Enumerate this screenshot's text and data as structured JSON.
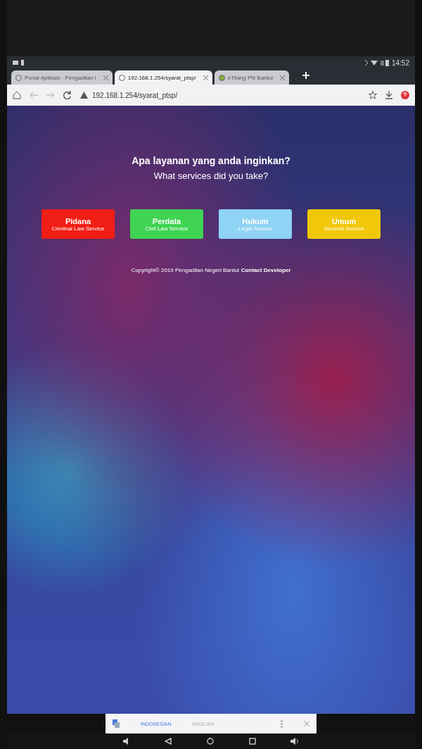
{
  "status_bar": {
    "time": "14:52"
  },
  "tabs": [
    {
      "title": "Portal Aplikasi - Pengadilan I",
      "selected": false
    },
    {
      "title": "192.168.1.254/syarat_ptsp/",
      "selected": true
    },
    {
      "title": "eTilang PN Bantul",
      "selected": false
    }
  ],
  "address_bar": {
    "url": "192.168.1.254/syarat_ptsp/"
  },
  "page": {
    "heading": "Apa layanan yang anda inginkan?",
    "subheading": "What services did you take?",
    "services": [
      {
        "title": "Pidana",
        "subtitle": "Criminal Law Service",
        "color": "#f01e14"
      },
      {
        "title": "Perdata",
        "subtitle": "Civil Law Service",
        "color": "#3fd452"
      },
      {
        "title": "Hukum",
        "subtitle": "Legal Service",
        "color": "#8fd3f5"
      },
      {
        "title": "Umum",
        "subtitle": "General Service",
        "color": "#f0c808"
      }
    ],
    "footer": "Copyright© 2019 Pengadilan Negeri Bantul",
    "footer_link": "Contact Developer"
  },
  "translate_bar": {
    "languages": [
      {
        "label": "INDONESIAN",
        "selected": true
      },
      {
        "label": "ENGLISH",
        "selected": false
      }
    ]
  }
}
